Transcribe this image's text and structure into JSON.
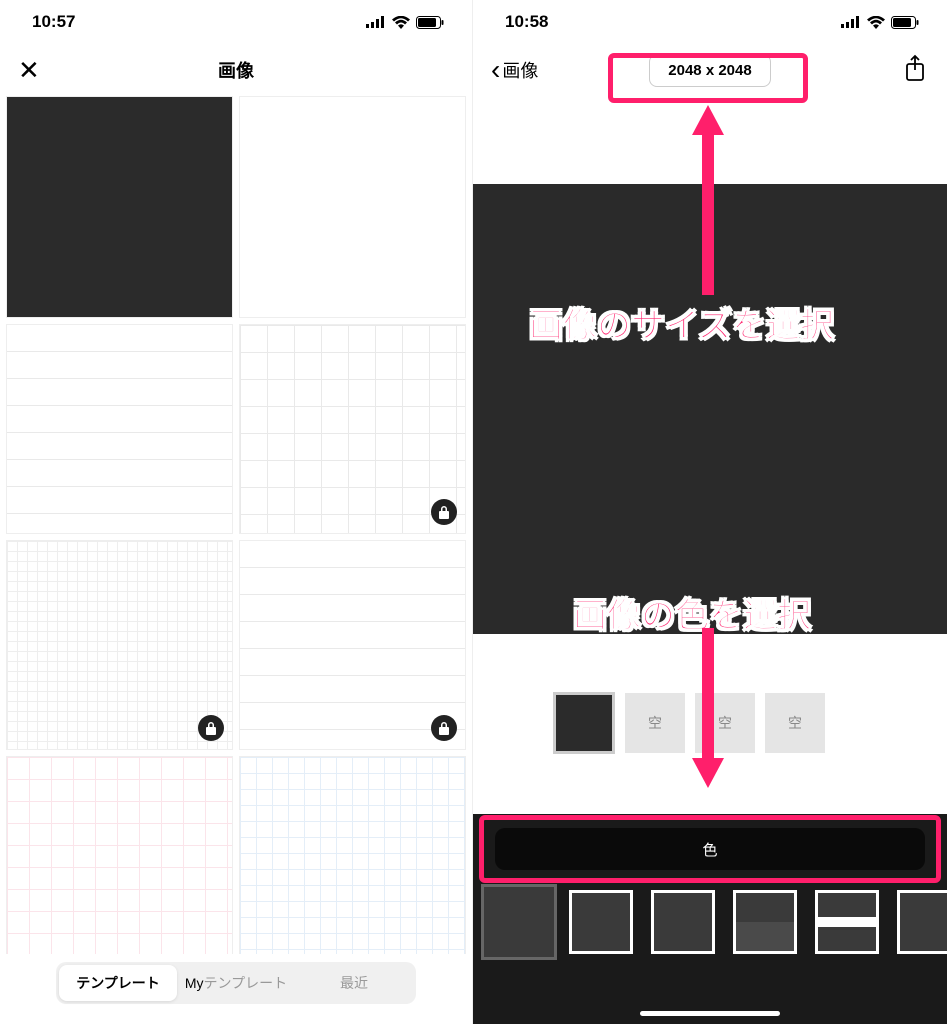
{
  "left": {
    "status_time": "10:57",
    "nav_title": "画像",
    "segmented": {
      "template": "テンプレート",
      "my_prefix": "My",
      "my_suffix": "テンプレート",
      "recent": "最近"
    }
  },
  "right": {
    "status_time": "10:58",
    "back_label": "画像",
    "size_button": "2048 x 2048",
    "preset_empty": "空",
    "color_label": "色"
  },
  "annotations": {
    "size_text": "画像のサイズを選択",
    "color_text": "画像の色を選択"
  }
}
